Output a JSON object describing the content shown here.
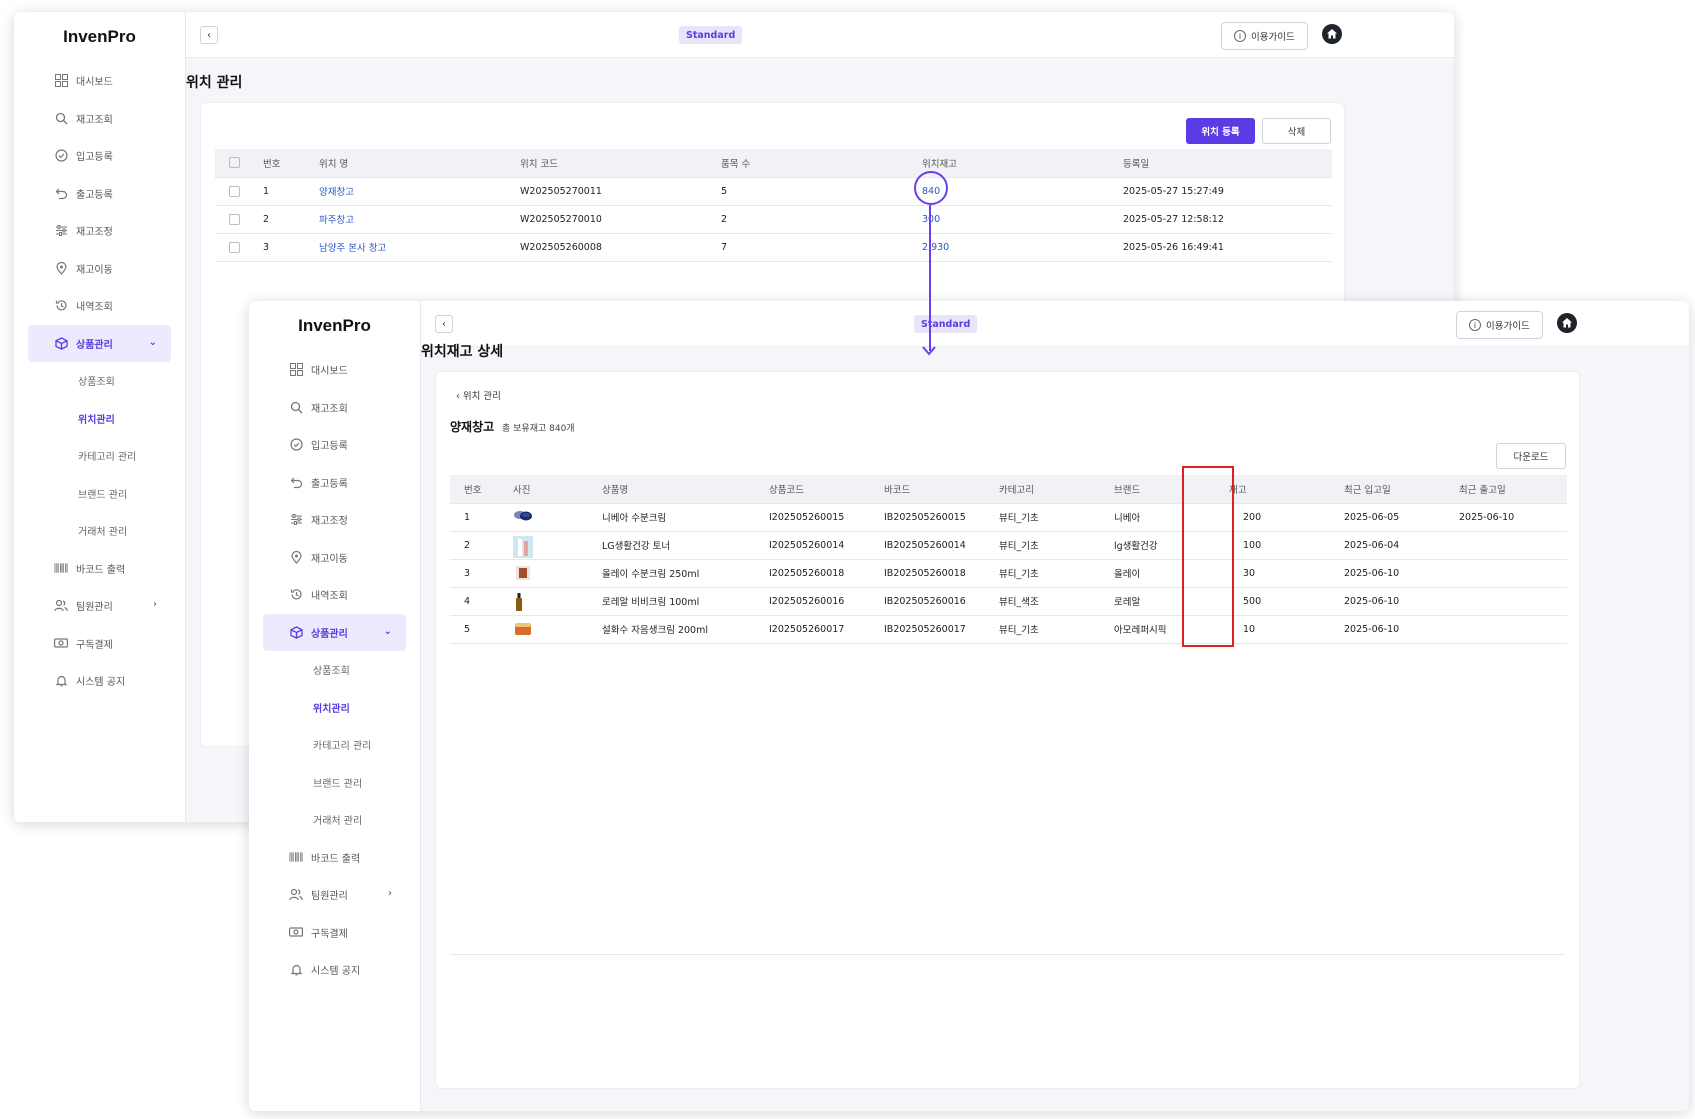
{
  "app": {
    "name": "InvenPro",
    "plan_badge": "Standard",
    "guide_label": "이용가이드"
  },
  "sidebar": {
    "items": [
      {
        "label": "대시보드",
        "icon": "dashboard-icon"
      },
      {
        "label": "재고조회",
        "icon": "search-icon"
      },
      {
        "label": "입고등록",
        "icon": "check-circle-icon"
      },
      {
        "label": "출고등록",
        "icon": "undo-arrow-icon"
      },
      {
        "label": "재고조정",
        "icon": "sliders-icon"
      },
      {
        "label": "재고이동",
        "icon": "location-pin-icon"
      },
      {
        "label": "내역조회",
        "icon": "history-icon"
      },
      {
        "label": "상품관리",
        "icon": "box-icon"
      }
    ],
    "sub_items": [
      "상품조회",
      "위치관리",
      "카테고리 관리",
      "브랜드 관리",
      "거래처 관리"
    ],
    "bottom_items": [
      {
        "label": "바코드 출력",
        "icon": "barcode-icon"
      },
      {
        "label": "팀원관리",
        "icon": "users-icon"
      },
      {
        "label": "구독결제",
        "icon": "payment-icon"
      },
      {
        "label": "시스템 공지",
        "icon": "bell-icon"
      }
    ]
  },
  "location_page": {
    "title": "위치 관리",
    "register_button": "위치 등록",
    "delete_button": "삭제",
    "columns": [
      "번호",
      "위치 명",
      "위치 코드",
      "품목 수",
      "위치재고",
      "등록일"
    ],
    "rows": [
      {
        "no": "1",
        "name": "양재창고",
        "code": "W202505270011",
        "items": "5",
        "stock": "840",
        "date": "2025-05-27 15:27:49"
      },
      {
        "no": "2",
        "name": "파주창고",
        "code": "W202505270010",
        "items": "2",
        "stock": "300",
        "date": "2025-05-27 12:58:12"
      },
      {
        "no": "3",
        "name": "남양주 본사 창고",
        "code": "W202505260008",
        "items": "7",
        "stock": "2,930",
        "date": "2025-05-26 16:49:41"
      }
    ]
  },
  "detail_page": {
    "title": "위치재고 상세",
    "breadcrumb": "위치 관리",
    "location_name": "양재창고",
    "total_stock_text": "총 보유재고 840개",
    "download_button": "다운로드",
    "columns": [
      "번호",
      "사진",
      "상품명",
      "상품코드",
      "바코드",
      "카테고리",
      "브랜드",
      "재고",
      "최근 입고일",
      "최근 출고일"
    ],
    "rows": [
      {
        "no": "1",
        "photo": "cream-jar",
        "name": "니베아 수분크림",
        "code": "I202505260015",
        "barcode": "IB202505260015",
        "category": "뷰티_기초",
        "brand": "니베아",
        "stock": "200",
        "last_in": "2025-06-05",
        "last_out": "2025-06-10"
      },
      {
        "no": "2",
        "photo": "toner-bottles",
        "name": "LG생활건강 토너",
        "code": "I202505260014",
        "barcode": "IB202505260014",
        "category": "뷰티_기초",
        "brand": "lg생활건강",
        "stock": "100",
        "last_in": "2025-06-04",
        "last_out": ""
      },
      {
        "no": "3",
        "photo": "cream-tube",
        "name": "올레이 수분크림 250ml",
        "code": "I202505260018",
        "barcode": "IB202505260018",
        "category": "뷰티_기초",
        "brand": "올레이",
        "stock": "30",
        "last_in": "2025-06-10",
        "last_out": ""
      },
      {
        "no": "4",
        "photo": "bb-bottle",
        "name": "로레알 비비크림 100ml",
        "code": "I202505260016",
        "barcode": "IB202505260016",
        "category": "뷰티_색조",
        "brand": "로레알",
        "stock": "500",
        "last_in": "2025-06-10",
        "last_out": ""
      },
      {
        "no": "5",
        "photo": "cream-pot",
        "name": "설화수 자음생크림 200ml",
        "code": "I202505260017",
        "barcode": "IB202505260017",
        "category": "뷰티_기초",
        "brand": "아모레퍼시픽",
        "stock": "10",
        "last_in": "2025-06-10",
        "last_out": ""
      }
    ]
  },
  "colors": {
    "accent": "#5b3be3",
    "link": "#2c58c4",
    "highlight": "#e02020"
  }
}
